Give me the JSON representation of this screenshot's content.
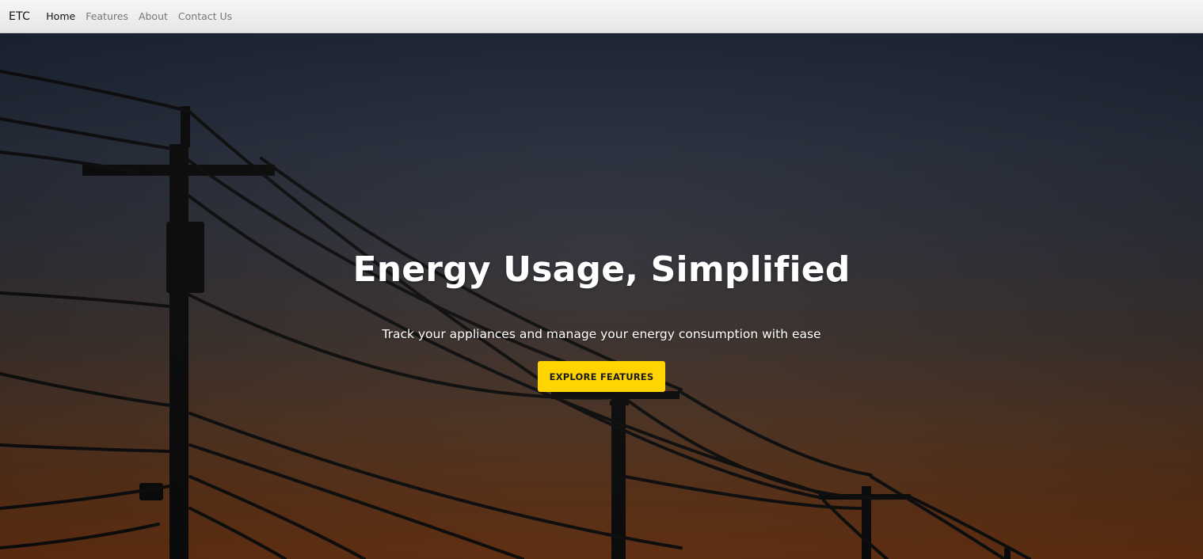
{
  "navbar": {
    "brand": "ETC",
    "links": [
      {
        "label": "Home",
        "active": true
      },
      {
        "label": "Features",
        "active": false
      },
      {
        "label": "About",
        "active": false
      },
      {
        "label": "Contact Us",
        "active": false
      }
    ]
  },
  "hero": {
    "title": "Energy Usage, Simplified",
    "subtitle": "Track your appliances and manage your energy consumption with ease",
    "cta_label": "EXPLORE FEATURES",
    "background_image": "power-lines-silhouette-at-dusk"
  },
  "colors": {
    "accent": "#ffd400",
    "sky_top": "#1c2535",
    "sky_bottom": "#6b3312",
    "nav_active": "#111111",
    "nav_inactive": "#777777"
  }
}
